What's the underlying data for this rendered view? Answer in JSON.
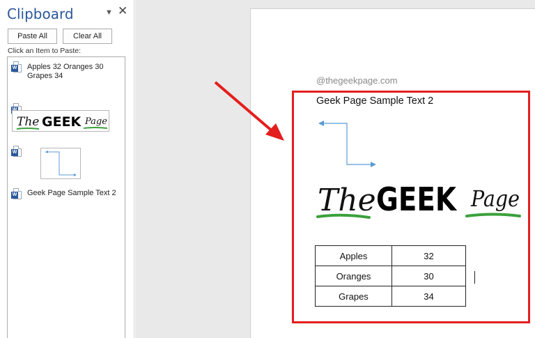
{
  "clipboard_pane": {
    "title": "Clipboard",
    "menu_icon": "dropdown-triangle-icon",
    "close_icon": "close-icon",
    "paste_all_label": "Paste All",
    "clear_all_label": "Clear All",
    "instruction": "Click an Item to Paste:",
    "items": [
      {
        "type": "text",
        "icon": "word-doc-icon",
        "text": "Apples 32 Oranges 30 Grapes 34"
      },
      {
        "type": "image",
        "icon": "word-doc-icon",
        "preview": "the-geek-page-logo"
      },
      {
        "type": "image",
        "icon": "word-doc-icon",
        "preview": "connector-arrows"
      },
      {
        "type": "text",
        "icon": "word-doc-icon",
        "text": "Geek Page Sample Text 2"
      }
    ]
  },
  "document": {
    "watermark": "@thegeekpage.com",
    "heading": "Geek Page Sample Text 2",
    "logo_text": {
      "the": "The",
      "geek": "GEEK",
      "page": "Page"
    },
    "table": {
      "rows": [
        {
          "item": "Apples",
          "count": "32"
        },
        {
          "item": "Oranges",
          "count": "30"
        },
        {
          "item": "Grapes",
          "count": "34"
        }
      ]
    }
  },
  "colors": {
    "accent": "#2b579a",
    "highlight": "#e41e1e",
    "arrow_line": "#5b9bd5",
    "logo_underline": "#3aa13a"
  }
}
